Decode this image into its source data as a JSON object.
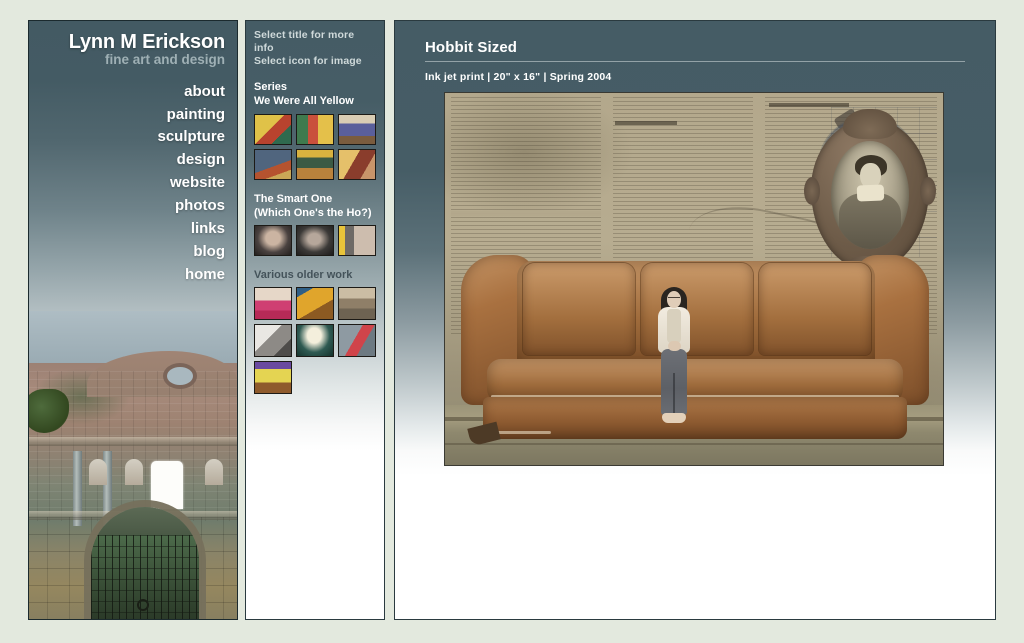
{
  "site": {
    "brand_name": "Lynn M Erickson",
    "tagline": "fine art and design"
  },
  "nav": {
    "items": [
      {
        "label": "about"
      },
      {
        "label": "painting"
      },
      {
        "label": "sculpture"
      },
      {
        "label": "design"
      },
      {
        "label": "website"
      },
      {
        "label": "photos"
      },
      {
        "label": "links"
      },
      {
        "label": "blog"
      },
      {
        "label": "home"
      }
    ]
  },
  "left_panel": {
    "photo_name": "colonial-church-ruins-photo"
  },
  "gallery_panel": {
    "hints": [
      "Select title for more info",
      "Select icon for image"
    ],
    "sections": [
      {
        "kicker": "Series",
        "title": "We Were All Yellow",
        "thumb_count": 6,
        "thumbs": [
          {
            "name": "thumb-yellow-1",
            "fill": "t-y1"
          },
          {
            "name": "thumb-yellow-2",
            "fill": "t-y2"
          },
          {
            "name": "thumb-yellow-3",
            "fill": "t-y3"
          },
          {
            "name": "thumb-yellow-4",
            "fill": "t-y4"
          },
          {
            "name": "thumb-yellow-5",
            "fill": "t-y5"
          },
          {
            "name": "thumb-yellow-6",
            "fill": "t-y6"
          }
        ]
      },
      {
        "kicker": "The Smart One",
        "title": "(Which One's the Ho?)",
        "thumb_count": 3,
        "thumbs": [
          {
            "name": "thumb-smart-1",
            "fill": "t-s1"
          },
          {
            "name": "thumb-smart-2",
            "fill": "t-s2"
          },
          {
            "name": "thumb-smart-3",
            "fill": "t-s3"
          }
        ]
      },
      {
        "kicker": "",
        "title": "Various older work",
        "thumb_count": 7,
        "thumbs": [
          {
            "name": "thumb-older-1",
            "fill": "t-o1"
          },
          {
            "name": "thumb-older-2",
            "fill": "t-o2"
          },
          {
            "name": "thumb-older-3",
            "fill": "t-o3"
          },
          {
            "name": "thumb-older-4",
            "fill": "t-o4"
          },
          {
            "name": "thumb-older-5",
            "fill": "t-o5"
          },
          {
            "name": "thumb-older-6",
            "fill": "t-o6"
          },
          {
            "name": "thumb-older-7",
            "fill": "t-o7"
          }
        ]
      }
    ]
  },
  "artwork": {
    "title": "Hobbit Sized",
    "meta": "Ink jet print | 20\" x 16\" | Spring 2004",
    "medium": "Ink jet print",
    "dimensions": "20\" x 16\"",
    "date": "Spring 2004",
    "description": "Sepia photo-collage: a small seated woman on an oversized tufted couch, aged newsprint ground, ornate oval Victorian portrait, rotary telephone",
    "elements": [
      "newsprint-background",
      "drawn-clock-face",
      "oval-portrait-frame",
      "oversized-couch",
      "seated-woman",
      "rotary-telephone"
    ]
  },
  "colors": {
    "page_background": "#e3e9de",
    "panel_top": "#455c65",
    "panel_bottom": "#ffffff",
    "heading_text": "#ffffff",
    "tagline_text": "#9fb0b5",
    "hint_text": "#cfd9da",
    "dark_section_title": "#44535a",
    "rule": "#93a2a7",
    "panel_border": "#2a3a3f"
  }
}
